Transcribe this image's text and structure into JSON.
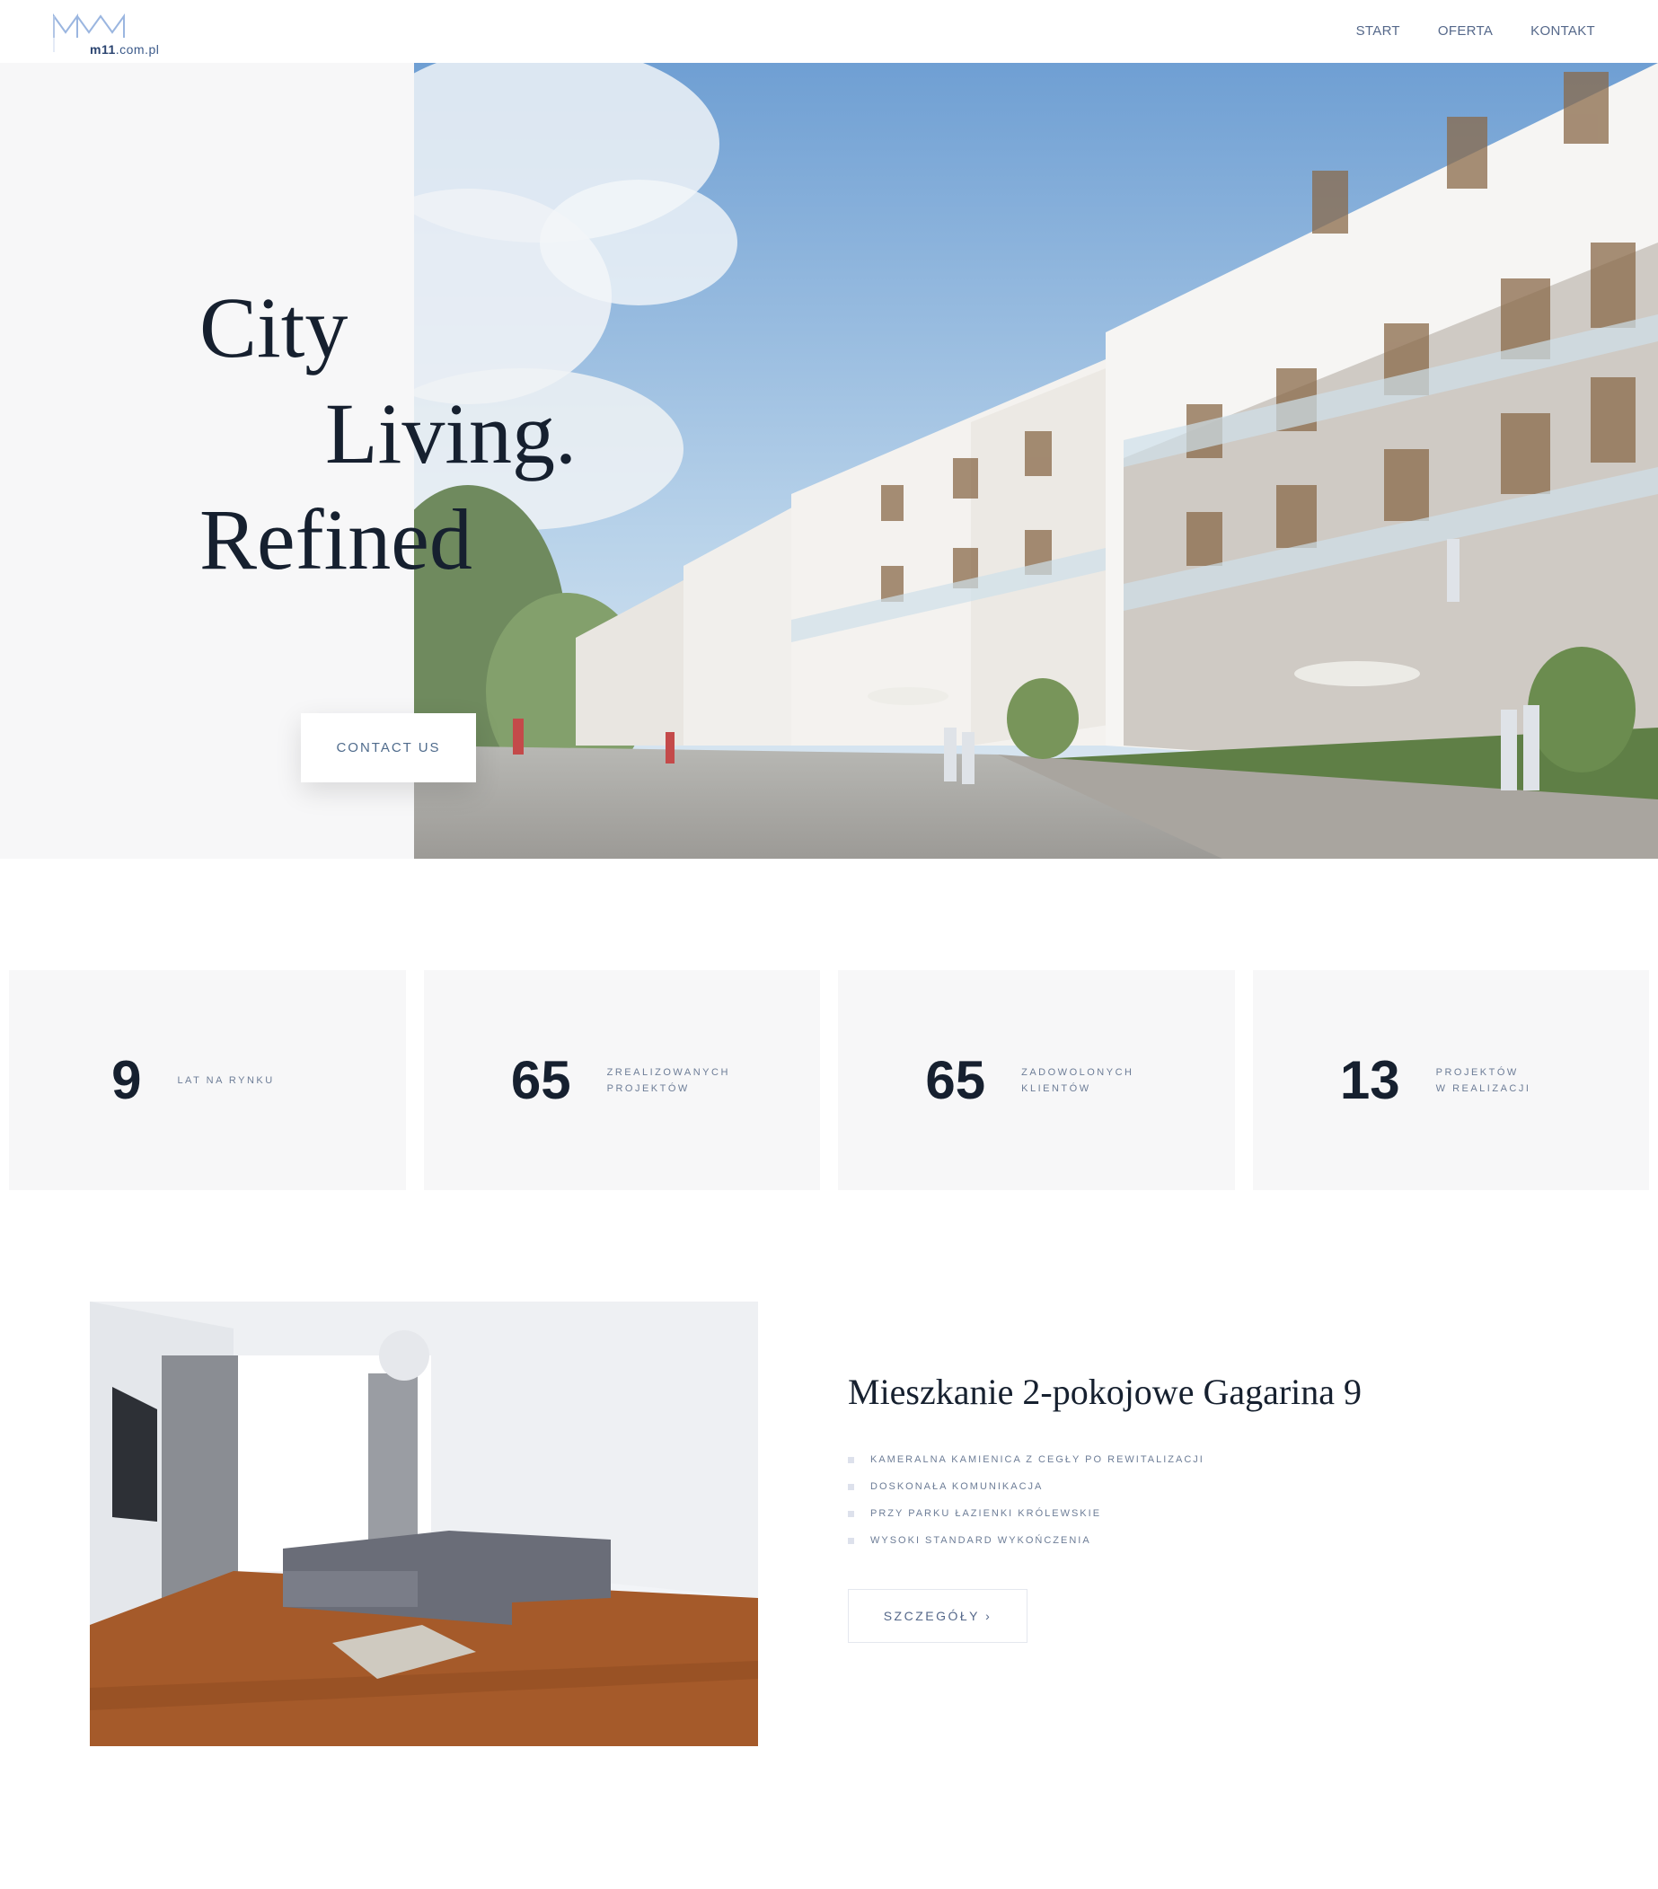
{
  "header": {
    "logo_text_bold": "m11",
    "logo_text_rest": ".com.pl",
    "nav": [
      {
        "label": "START"
      },
      {
        "label": "OFERTA"
      },
      {
        "label": "KONTAKT"
      }
    ]
  },
  "hero": {
    "title_line1": "City",
    "title_line2": "Living.",
    "title_line3": "Refined",
    "cta_label": "CONTACT US"
  },
  "stats": [
    {
      "value": "9",
      "label_line1": "LAT NA RYNKU",
      "label_line2": ""
    },
    {
      "value": "65",
      "label_line1": "ZREALIZOWANYCH",
      "label_line2": "PROJEKTÓW"
    },
    {
      "value": "65",
      "label_line1": "ZADOWOLONYCH",
      "label_line2": "KLIENTÓW"
    },
    {
      "value": "13",
      "label_line1": "PROJEKTÓW",
      "label_line2": "W REALIZACJI"
    }
  ],
  "listing": {
    "title": "Mieszkanie 2-pokojowe Gagarina 9",
    "features": [
      "KAMERALNA KAMIENICA Z CEGŁY PO REWITALIZACJI",
      "DOSKONAŁA KOMUNIKACJA",
      "PRZY PARKU ŁAZIENKI KRÓLEWSKIE",
      "WYSOKI STANDARD WYKOŃCZENIA"
    ],
    "details_label": "SZCZEGÓŁY ›"
  },
  "colors": {
    "accent": "#55688a",
    "heading": "#16202f",
    "panel": "#f7f7f8",
    "logo": "#9bb6e0"
  }
}
